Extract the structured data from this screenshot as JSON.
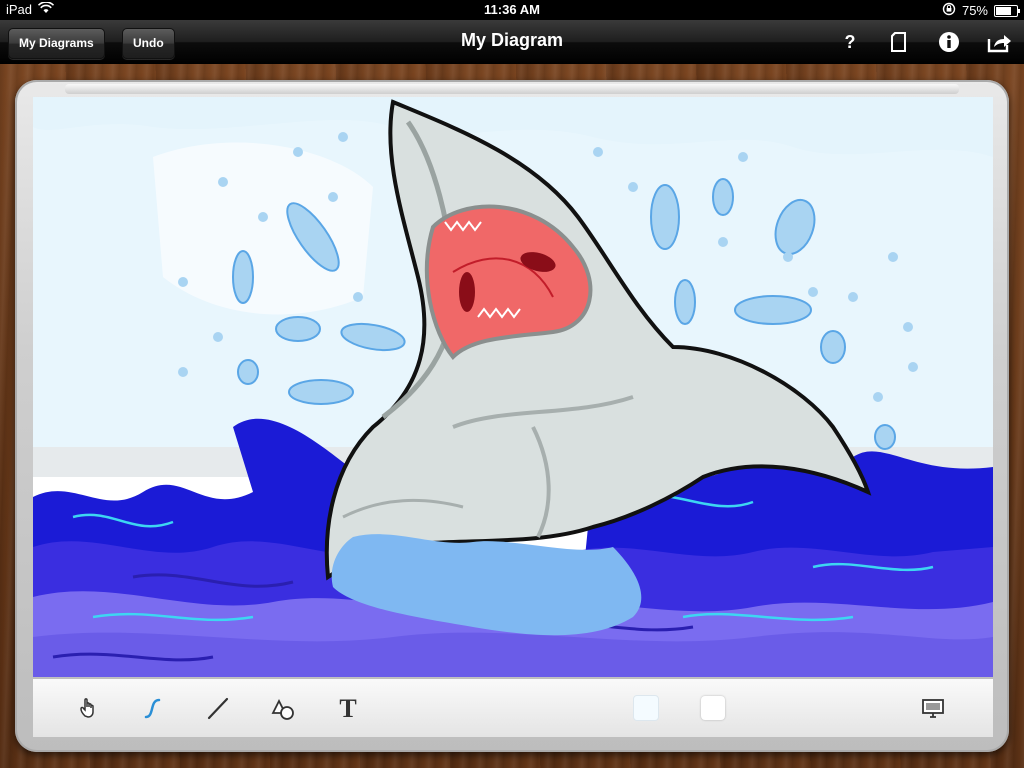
{
  "status_bar": {
    "device": "iPad",
    "time": "11:36 AM",
    "battery_percent": "75%",
    "battery_level": 0.75
  },
  "nav_bar": {
    "back_label": "My Diagrams",
    "undo_label": "Undo",
    "title": "My Diagram",
    "right_icons": [
      "help-icon",
      "page-icon",
      "info-icon",
      "share-icon"
    ],
    "help_glyph": "?"
  },
  "toolbar": {
    "tools": [
      "hand-tool-icon",
      "freehand-pen-icon",
      "line-tool-icon",
      "shape-tool-icon",
      "text-tool-icon"
    ],
    "text_glyph": "T",
    "selected_tool": "freehand-pen-icon",
    "color_swatches": [
      "#f4fbff",
      "#ffffff"
    ],
    "right_icon": "presentation-monitor-icon"
  },
  "colors": {
    "accent_blue": "#2a8fd6",
    "sky": "#e8f6fd",
    "ocean_dark": "#1b1bd6",
    "ocean_light": "#7a6cf0",
    "shark": "#d9e0df",
    "mouth": "#f06868"
  }
}
